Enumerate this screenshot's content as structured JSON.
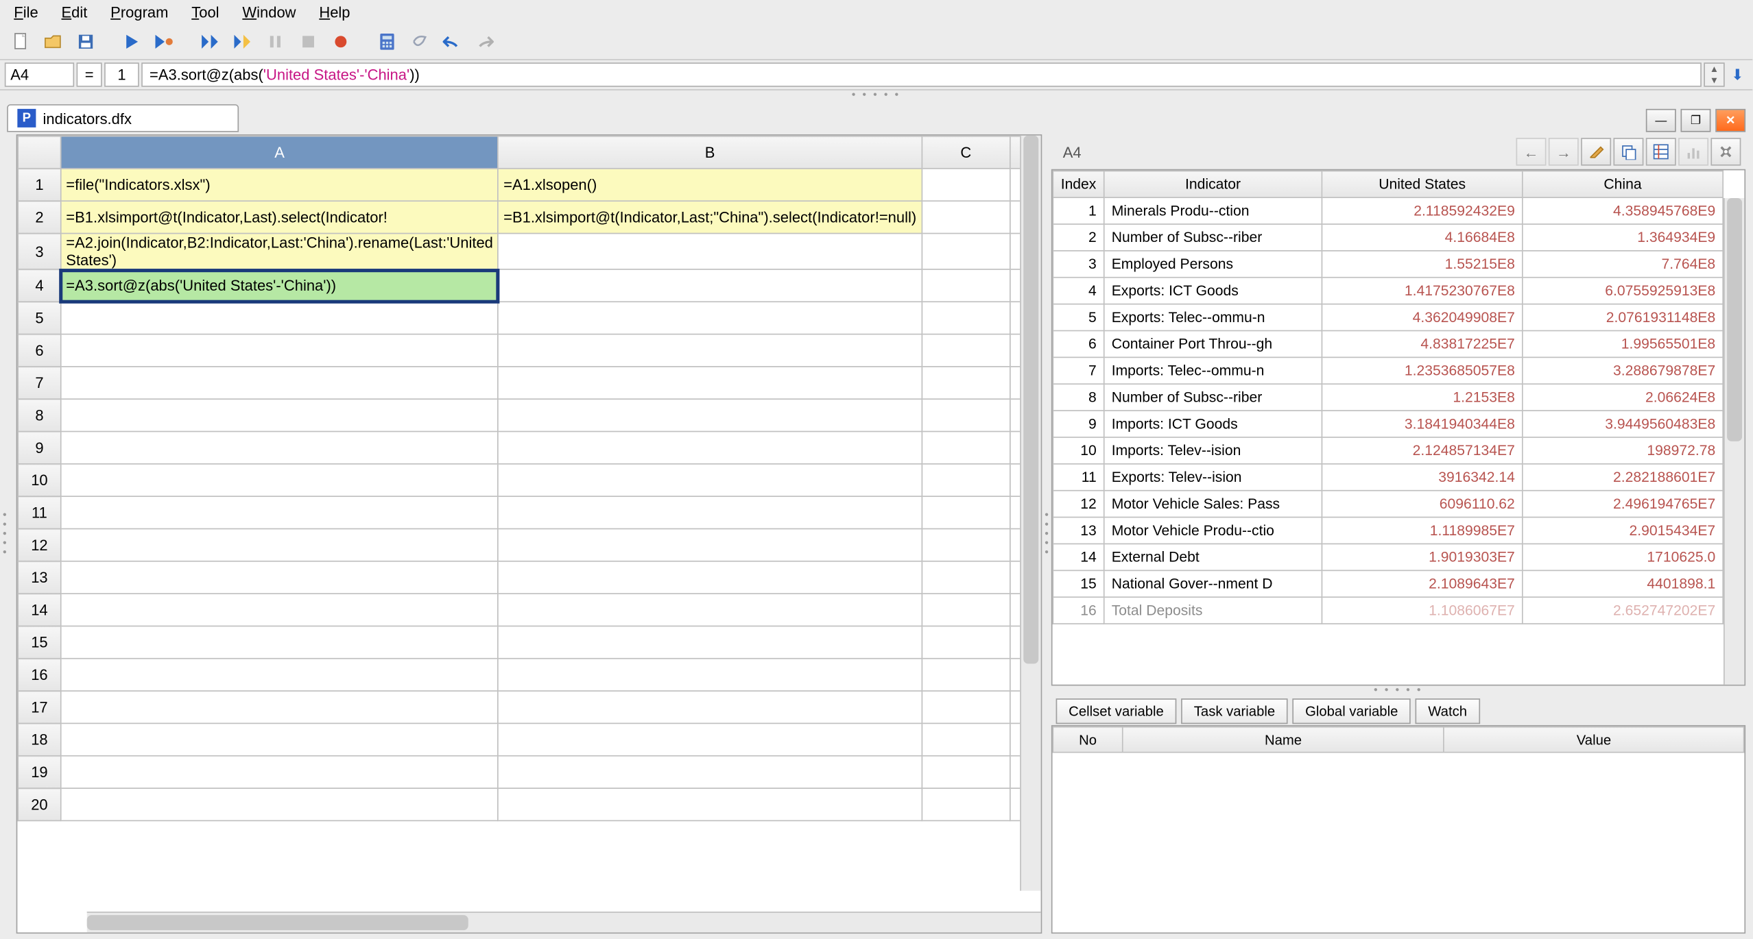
{
  "menu": {
    "file": "File",
    "edit": "Edit",
    "program": "Program",
    "tool": "Tool",
    "window": "Window",
    "help": "Help"
  },
  "formula": {
    "cell": "A4",
    "eq": "=",
    "line": "1",
    "prefix": "=A3.sort@z(abs(",
    "string": "'United States'-'China'",
    "suffix": "))"
  },
  "tab": {
    "title": "indicators.dfx"
  },
  "sheet": {
    "cols": [
      "A",
      "B",
      "C"
    ],
    "rows": 20,
    "cells": {
      "A1": "=file(\"Indicators.xlsx\")",
      "B1": "=A1.xlsopen()",
      "A2": "=B1.xlsimport@t(Indicator,Last).select(Indicator!",
      "B2": "=B1.xlsimport@t(Indicator,Last;\"China\").select(Indicator!=null)",
      "A3": "=A2.join(Indicator,B2:Indicator,Last:'China').rename(Last:'United States')",
      "A4": "=A3.sort@z(abs('United States'-'China'))"
    }
  },
  "right": {
    "cellref": "A4",
    "headers": {
      "index": "Index",
      "indicator": "Indicator",
      "us": "United States",
      "china": "China"
    },
    "rows": [
      {
        "i": 1,
        "ind": "Minerals Produ--ction",
        "us": "2.118592432E9",
        "ch": "4.358945768E9"
      },
      {
        "i": 2,
        "ind": "Number of Subsc--riber",
        "us": "4.16684E8",
        "ch": "1.364934E9"
      },
      {
        "i": 3,
        "ind": "Employed Persons",
        "us": "1.55215E8",
        "ch": "7.764E8"
      },
      {
        "i": 4,
        "ind": "Exports: ICT Goods",
        "us": "1.4175230767E8",
        "ch": "6.0755925913E8"
      },
      {
        "i": 5,
        "ind": "Exports: Telec--ommu-n",
        "us": "4.362049908E7",
        "ch": "2.0761931148E8"
      },
      {
        "i": 6,
        "ind": "Container Port Throu--gh",
        "us": "4.83817225E7",
        "ch": "1.99565501E8"
      },
      {
        "i": 7,
        "ind": "Imports: Telec--ommu-n",
        "us": "1.2353685057E8",
        "ch": "3.288679878E7"
      },
      {
        "i": 8,
        "ind": "Number of Subsc--riber",
        "us": "1.2153E8",
        "ch": "2.06624E8"
      },
      {
        "i": 9,
        "ind": "Imports: ICT Goods",
        "us": "3.1841940344E8",
        "ch": "3.9449560483E8"
      },
      {
        "i": 10,
        "ind": "Imports: Telev--ision",
        "us": "2.124857134E7",
        "ch": "198972.78"
      },
      {
        "i": 11,
        "ind": "Exports: Telev--ision",
        "us": "3916342.14",
        "ch": "2.282188601E7"
      },
      {
        "i": 12,
        "ind": "Motor Vehicle Sales: Pass",
        "us": "6096110.62",
        "ch": "2.496194765E7"
      },
      {
        "i": 13,
        "ind": "Motor Vehicle Produ--ctio",
        "us": "1.1189985E7",
        "ch": "2.9015434E7"
      },
      {
        "i": 14,
        "ind": "External Debt",
        "us": "1.9019303E7",
        "ch": "1710625.0"
      },
      {
        "i": 15,
        "ind": "National Gover--nment D",
        "us": "2.1089643E7",
        "ch": "4401898.1"
      },
      {
        "i": 16,
        "ind": "Total Deposits",
        "us": "1.1086067E7",
        "ch": "2.652747202E7"
      }
    ]
  },
  "tabs": {
    "cellset": "Cellset variable",
    "task": "Task variable",
    "global": "Global variable",
    "watch": "Watch"
  },
  "var": {
    "no": "No",
    "name": "Name",
    "value": "Value"
  }
}
